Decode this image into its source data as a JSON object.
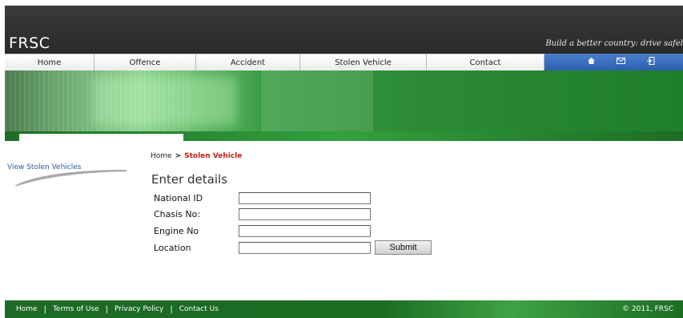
{
  "header": {
    "logo": "FRSC",
    "tagline": "Build a better country: drive safel"
  },
  "nav": {
    "items": [
      {
        "label": "Home"
      },
      {
        "label": "Offence"
      },
      {
        "label": "Accident"
      },
      {
        "label": "Stolen Vehicle"
      },
      {
        "label": "Contact"
      }
    ],
    "icons": [
      "home-icon",
      "mail-icon",
      "logout-icon"
    ]
  },
  "sidebar": {
    "link": "View Stolen Vehicles"
  },
  "breadcrumb": {
    "home": "Home",
    "separator": ">",
    "current": "Stolen Vehicle"
  },
  "form": {
    "title": "Enter details",
    "fields": [
      {
        "label": "National ID",
        "value": ""
      },
      {
        "label": "Chasis No:",
        "value": ""
      },
      {
        "label": "Engine No",
        "value": ""
      },
      {
        "label": "Location",
        "value": ""
      }
    ],
    "submit_label": "Submit"
  },
  "footer": {
    "links": [
      "Home",
      "Terms of Use",
      "Privacy Policy",
      "Contact Us"
    ],
    "separator": "|",
    "copyright": "© 2011, FRSC"
  },
  "colors": {
    "header_bg": "#2e2e2e",
    "nav_icons_bg": "#2c5fab",
    "banner_green": "#2d8b36",
    "breadcrumb_current": "#c0201c",
    "sidebar_link": "#2a58a0",
    "footer_bg": "#1d6a24"
  }
}
